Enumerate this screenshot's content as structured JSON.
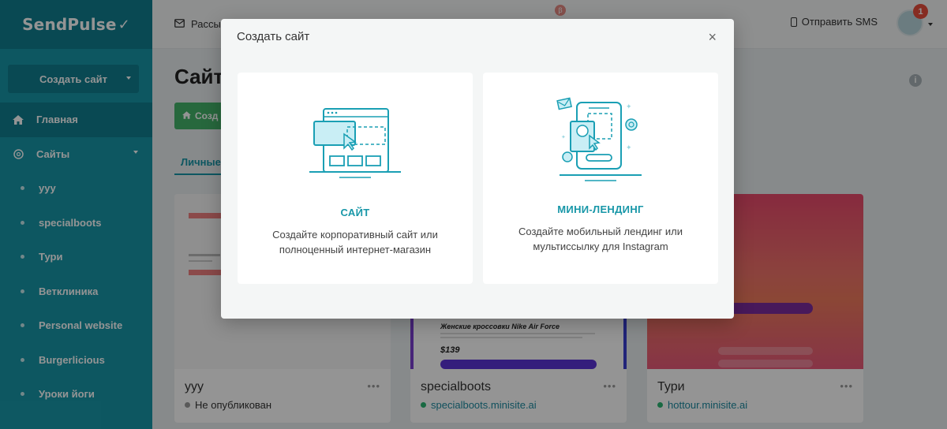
{
  "brand": {
    "name": "SendPulse",
    "accent": "#1897a8",
    "accent_dark": "#107f8f"
  },
  "sidebar": {
    "create_button": "Создать сайт",
    "nav": [
      {
        "label": "Главная",
        "icon": "home-icon"
      },
      {
        "label": "Сайты",
        "icon": "sites-icon"
      }
    ],
    "sites": [
      "yyy",
      "specialboots",
      "Тури",
      "Ветклиника",
      "Personal website",
      "Burgerlicious",
      "Уроки йоги"
    ]
  },
  "topbar": {
    "menu_first": "Рассы",
    "send_sms": "Отправить SMS",
    "notification_count": "1",
    "small_badge": "β"
  },
  "main": {
    "title": "Сайт",
    "create_button": "Созд",
    "tab_personal": "Личные"
  },
  "cards": [
    {
      "name": "yyy",
      "status": "Не опубликован"
    },
    {
      "name": "specialboots",
      "status": "specialboots.minisite.ai"
    },
    {
      "name": "Тури",
      "status": "hottour.minisite.ai"
    }
  ],
  "card_preview": {
    "product": "Женские кроссовки Nike Air Force",
    "price": "$139"
  },
  "modal": {
    "title": "Создать сайт",
    "close": "×",
    "options": [
      {
        "title": "САЙТ",
        "desc_line1": "Создайте корпоративный сайт или",
        "desc_line2": "полноценный интернет-магазин"
      },
      {
        "title": "МИНИ-ЛЕНДИНГ",
        "desc_line1": "Создайте мобильный лендинг или",
        "desc_line2": "мультиссылку для Instagram"
      }
    ]
  }
}
